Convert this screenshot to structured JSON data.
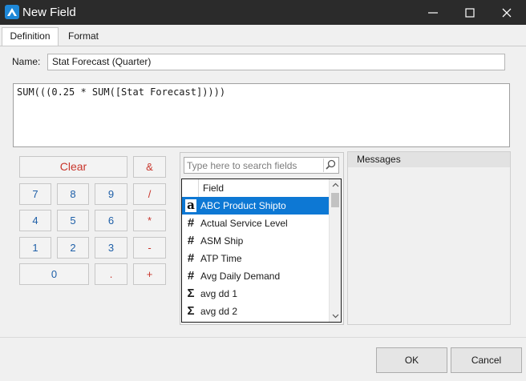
{
  "window": {
    "title": "New Field"
  },
  "tabs": [
    {
      "label": "Definition"
    },
    {
      "label": "Format"
    }
  ],
  "name": {
    "label": "Name:",
    "value": "Stat Forecast (Quarter)"
  },
  "formula": {
    "text": "SUM(((0.25 * SUM([Stat Forecast]))))"
  },
  "calculator": {
    "clear": "Clear",
    "concat": "&",
    "seven": "7",
    "eight": "8",
    "nine": "9",
    "divide": "/",
    "four": "4",
    "five": "5",
    "six": "6",
    "multiply": "*",
    "one": "1",
    "two": "2",
    "three": "3",
    "minus": "-",
    "zero": "0",
    "decimal": ".",
    "plus": "+"
  },
  "fields": {
    "search_placeholder": "Type here to search fields",
    "header": "Field",
    "items": [
      {
        "icon": "a",
        "icon_name": "text-type-icon",
        "label": "ABC Product Shipto",
        "selected": true
      },
      {
        "icon": "#",
        "icon_name": "number-type-icon",
        "label": "Actual Service Level"
      },
      {
        "icon": "#",
        "icon_name": "number-type-icon",
        "label": "ASM Ship"
      },
      {
        "icon": "#",
        "icon_name": "number-type-icon",
        "label": "ATP Time"
      },
      {
        "icon": "#",
        "icon_name": "number-type-icon",
        "label": "Avg Daily Demand"
      },
      {
        "icon": "Σ",
        "icon_name": "sigma-icon",
        "label": "avg dd 1"
      },
      {
        "icon": "Σ",
        "icon_name": "sigma-icon",
        "label": "avg dd 2"
      }
    ]
  },
  "messages": {
    "header": "Messages"
  },
  "dialog": {
    "ok": "OK",
    "cancel": "Cancel"
  },
  "colors": {
    "accent": "#0d78d4",
    "titlebar": "#2b2b2b",
    "operator": "#c8352b",
    "digit": "#1e5fa8"
  }
}
